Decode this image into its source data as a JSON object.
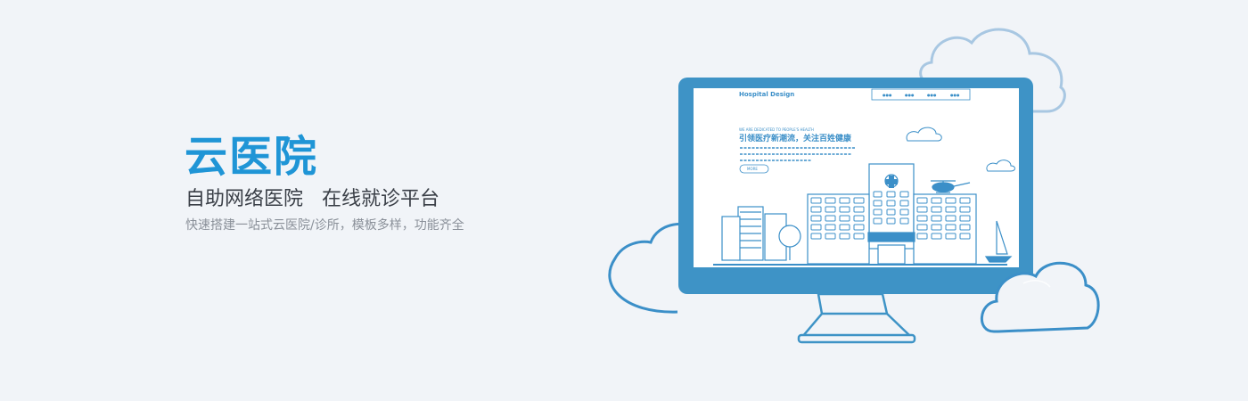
{
  "hero": {
    "title": "云医院",
    "subtitle": "自助网络医院   在线就诊平台",
    "description": "快速搭建一站式云医院/诊所，模板多样，功能齐全"
  },
  "screen": {
    "site_title": "Hospital Design",
    "nav_items": [
      "●●●",
      "●●●",
      "●●●",
      "●●●"
    ],
    "tagline_small": "WE ARE DEDICATED TO PEOPLE'S HEALTH",
    "headline": "引领医疗新潮流，关注百姓健康",
    "button_label": "MORE"
  },
  "colors": {
    "accent": "#1f95d6",
    "monitor": "#3e93c6",
    "cloud_outline": "#3b8fc8",
    "cloud_outline_light": "#a8c7e2",
    "background": "#f1f4f8"
  },
  "icons": [
    "cloud-icon",
    "monitor-icon",
    "hospital-icon",
    "helicopter-icon",
    "sailboat-icon"
  ]
}
